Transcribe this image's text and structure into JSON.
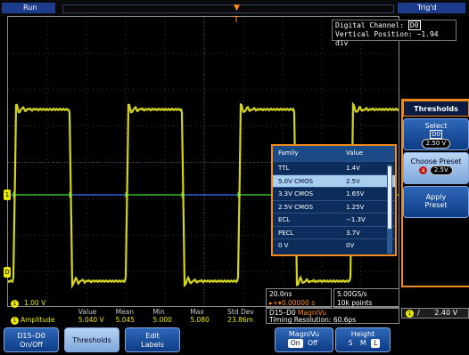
{
  "top_bar": {
    "run_status": "Run",
    "trigger_status": "Trig'd"
  },
  "digital_readout": {
    "line1_prefix": "Digital Channel:",
    "channel": "D0",
    "line2": "Vertical Position: −1.94 div"
  },
  "waveform": {
    "channel_marker": "1",
    "digital_marker": "D",
    "trigger_marker": "T"
  },
  "thresholds_table": {
    "header_family": "Family",
    "header_value": "Value",
    "rows": [
      {
        "family": "TTL",
        "value": "1.4V",
        "selected": false
      },
      {
        "family": "5.0V CMOS",
        "value": "2.5V",
        "selected": true
      },
      {
        "family": "3.3V CMOS",
        "value": "1.65V",
        "selected": false
      },
      {
        "family": "2.5V CMOS",
        "value": "1.25V",
        "selected": false
      },
      {
        "family": "ECL",
        "value": "−1.3V",
        "selected": false
      },
      {
        "family": "PECL",
        "value": "3.7V",
        "selected": false
      },
      {
        "family": "0 V",
        "value": "0V",
        "selected": false
      }
    ]
  },
  "side_menu": {
    "title": "Thresholds",
    "select_label": "Select",
    "select_channel": "D0",
    "select_value": "2.50 V",
    "choose_preset_label": "Choose Preset",
    "choose_preset_value": "2.5V",
    "choose_preset_knob": "a",
    "apply_preset_line1": "Apply",
    "apply_preset_line2": "Preset"
  },
  "ch1_strip": {
    "badge": "1",
    "scale": "1.00 V"
  },
  "measurements": {
    "headers": [
      "Value",
      "Mean",
      "Min",
      "Max",
      "Std Dev"
    ],
    "name": "Amplitude",
    "badge": "1",
    "values": [
      "5.040 V",
      "5.045",
      "5.000",
      "5.080",
      "23.86m"
    ]
  },
  "timebase": {
    "scale": "20.0ns",
    "trigger_offset": "▸+▾0.00000 s",
    "sample_rate": "5.00GS/s",
    "record_length": "10k points"
  },
  "magnivu": {
    "line1_prefix": "D15–D0",
    "line1_mode": "MagniVu",
    "line2": "Timing Resolution: 60.6ps"
  },
  "trigger_readout": {
    "badge": "1",
    "slope": "∕",
    "level": "2.40 V"
  },
  "bottom_menu": {
    "btn1_line1": "D15–D0",
    "btn1_line2": "On/Off",
    "btn2": "Thresholds",
    "btn3_line1": "Edit",
    "btn3_line2": "Labels",
    "magnivu_label": "MagniVu",
    "magnivu_on": "On",
    "magnivu_off": "Off",
    "height_label": "Height",
    "height_s": "S",
    "height_m": "M",
    "height_l": "L"
  },
  "colors": {
    "analog_trace": "#e6e620",
    "digital_high": "#30c030",
    "digital_low": "#2f5fd0",
    "accent_orange": "#f08a1a"
  }
}
